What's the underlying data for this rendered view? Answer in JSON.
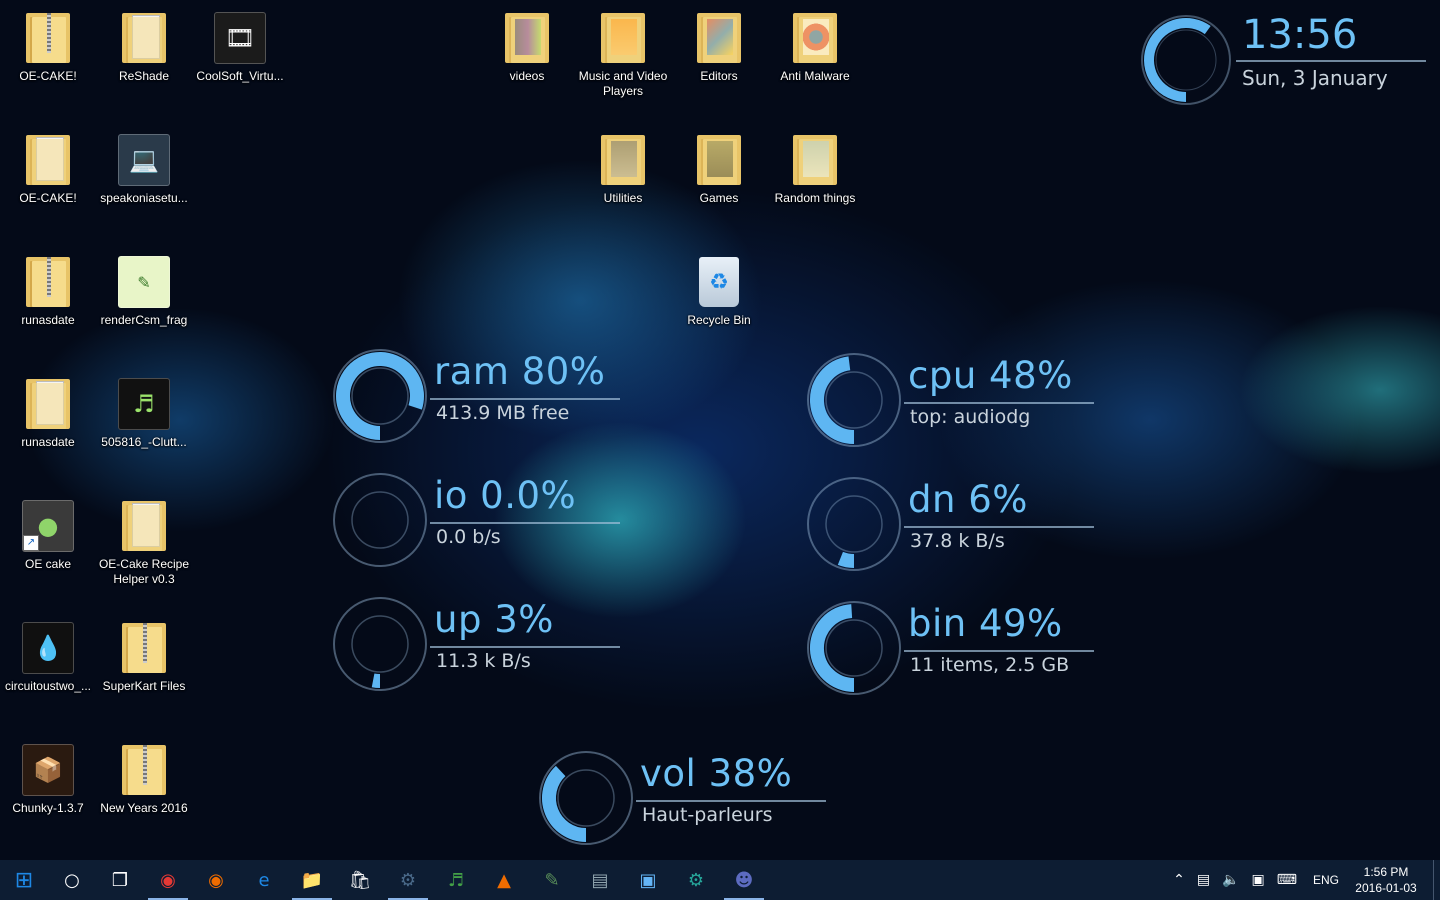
{
  "desktop": {
    "icons": [
      {
        "label": "OE-CAKE!",
        "icon": "zip-folder-icon",
        "col": 0,
        "row": 0
      },
      {
        "label": "ReShade",
        "icon": "folder-icon",
        "col": 1,
        "row": 0
      },
      {
        "label": "CoolSoft_Virtu...",
        "icon": "installer-icon",
        "col": 2,
        "row": 0
      },
      {
        "label": "OE-CAKE!",
        "icon": "folder-icon",
        "col": 0,
        "row": 1
      },
      {
        "label": "speakoniasetu...",
        "icon": "setup-icon",
        "col": 1,
        "row": 1
      },
      {
        "label": "runasdate",
        "icon": "zip-folder-icon",
        "col": 0,
        "row": 2
      },
      {
        "label": "renderCsm_frag",
        "icon": "notepad-icon",
        "col": 1,
        "row": 2
      },
      {
        "label": "runasdate",
        "icon": "folder-icon",
        "col": 0,
        "row": 3
      },
      {
        "label": "505816_-Clutt...",
        "icon": "music-app-icon",
        "col": 1,
        "row": 3
      },
      {
        "label": "OE cake",
        "icon": "oecake-shortcut-icon",
        "col": 0,
        "row": 4
      },
      {
        "label": "OE-Cake Recipe Helper v0.3",
        "icon": "folder-icon",
        "col": 1,
        "row": 4
      },
      {
        "label": "circuitoustwo_...",
        "icon": "droplet-icon",
        "col": 0,
        "row": 5
      },
      {
        "label": "SuperKart Files",
        "icon": "zip-folder-icon",
        "col": 1,
        "row": 5
      },
      {
        "label": "Chunky-1.3.7",
        "icon": "package-icon",
        "col": 0,
        "row": 6
      },
      {
        "label": "New Years 2016",
        "icon": "zip-folder-icon",
        "col": 1,
        "row": 6
      },
      {
        "label": "videos",
        "icon": "video-folder-icon",
        "col": 5,
        "row": 0
      },
      {
        "label": "Music and Video Players",
        "icon": "media-folder-icon",
        "col": 6,
        "row": 0
      },
      {
        "label": "Editors",
        "icon": "editors-folder-icon",
        "col": 7,
        "row": 0
      },
      {
        "label": "Anti Malware",
        "icon": "antimalware-folder-icon",
        "col": 8,
        "row": 0
      },
      {
        "label": "Utilities",
        "icon": "utilities-folder-icon",
        "col": 6,
        "row": 1
      },
      {
        "label": "Games",
        "icon": "games-folder-icon",
        "col": 7,
        "row": 1
      },
      {
        "label": "Random things",
        "icon": "random-folder-icon",
        "col": 8,
        "row": 1
      },
      {
        "label": "Recycle Bin",
        "icon": "recycle-bin-icon",
        "col": 7,
        "row": 2
      }
    ]
  },
  "clock": {
    "time": "13:56",
    "date": "Sun, 3 January",
    "ring_fraction": 0.6
  },
  "gauges": [
    {
      "key": "ram",
      "title": "ram 80%",
      "sub": "413.9 MB free",
      "fraction": 0.8
    },
    {
      "key": "cpu",
      "title": "cpu 48%",
      "sub": "top: audiodg",
      "fraction": 0.48
    },
    {
      "key": "io",
      "title": "io 0.0%",
      "sub": "0.0 b/s",
      "fraction": 0.0
    },
    {
      "key": "dn",
      "title": "dn 6%",
      "sub": "37.8 k B/s",
      "fraction": 0.06
    },
    {
      "key": "up",
      "title": "up 3%",
      "sub": "11.3 k B/s",
      "fraction": 0.03
    },
    {
      "key": "bin",
      "title": "bin 49%",
      "sub": "11 items, 2.5 GB",
      "fraction": 0.49
    },
    {
      "key": "vol",
      "title": "vol 38%",
      "sub": "Haut-parleurs",
      "fraction": 0.38
    }
  ],
  "taskbar": {
    "apps": [
      {
        "name": "start",
        "icon": "windows-start-icon",
        "color": "#1e88e5"
      },
      {
        "name": "search",
        "icon": "cortana-icon",
        "color": ""
      },
      {
        "name": "task-view",
        "icon": "task-view-icon",
        "color": ""
      },
      {
        "name": "chrome",
        "icon": "chrome-icon",
        "color": "#e53935",
        "active": true
      },
      {
        "name": "firefox",
        "icon": "firefox-icon",
        "color": "#ef6c00"
      },
      {
        "name": "edge",
        "icon": "edge-icon",
        "color": "#1e88e5"
      },
      {
        "name": "explorer",
        "icon": "file-explorer-icon",
        "color": "#f9c74f",
        "active": true
      },
      {
        "name": "store",
        "icon": "store-icon",
        "color": "#ffffff"
      },
      {
        "name": "steam",
        "icon": "steam-icon",
        "color": "#4a6a8a",
        "active": true
      },
      {
        "name": "fl-studio",
        "icon": "music-app-icon",
        "color": "#43a047"
      },
      {
        "name": "vlc",
        "icon": "vlc-icon",
        "color": "#ef6c00"
      },
      {
        "name": "editor",
        "icon": "notepad-icon",
        "color": "#5a8f5a"
      },
      {
        "name": "disk-tool",
        "icon": "disk-tool-icon",
        "color": "#90a4ae"
      },
      {
        "name": "control-panel",
        "icon": "control-panel-icon",
        "color": "#64b5f6"
      },
      {
        "name": "installer",
        "icon": "installer-icon",
        "color": "#26a69a"
      },
      {
        "name": "discord",
        "icon": "discord-icon",
        "color": "#5c6bc0",
        "active": true
      }
    ],
    "tray": {
      "lang": "ENG",
      "time": "1:56 PM",
      "date": "2016-01-03"
    }
  }
}
